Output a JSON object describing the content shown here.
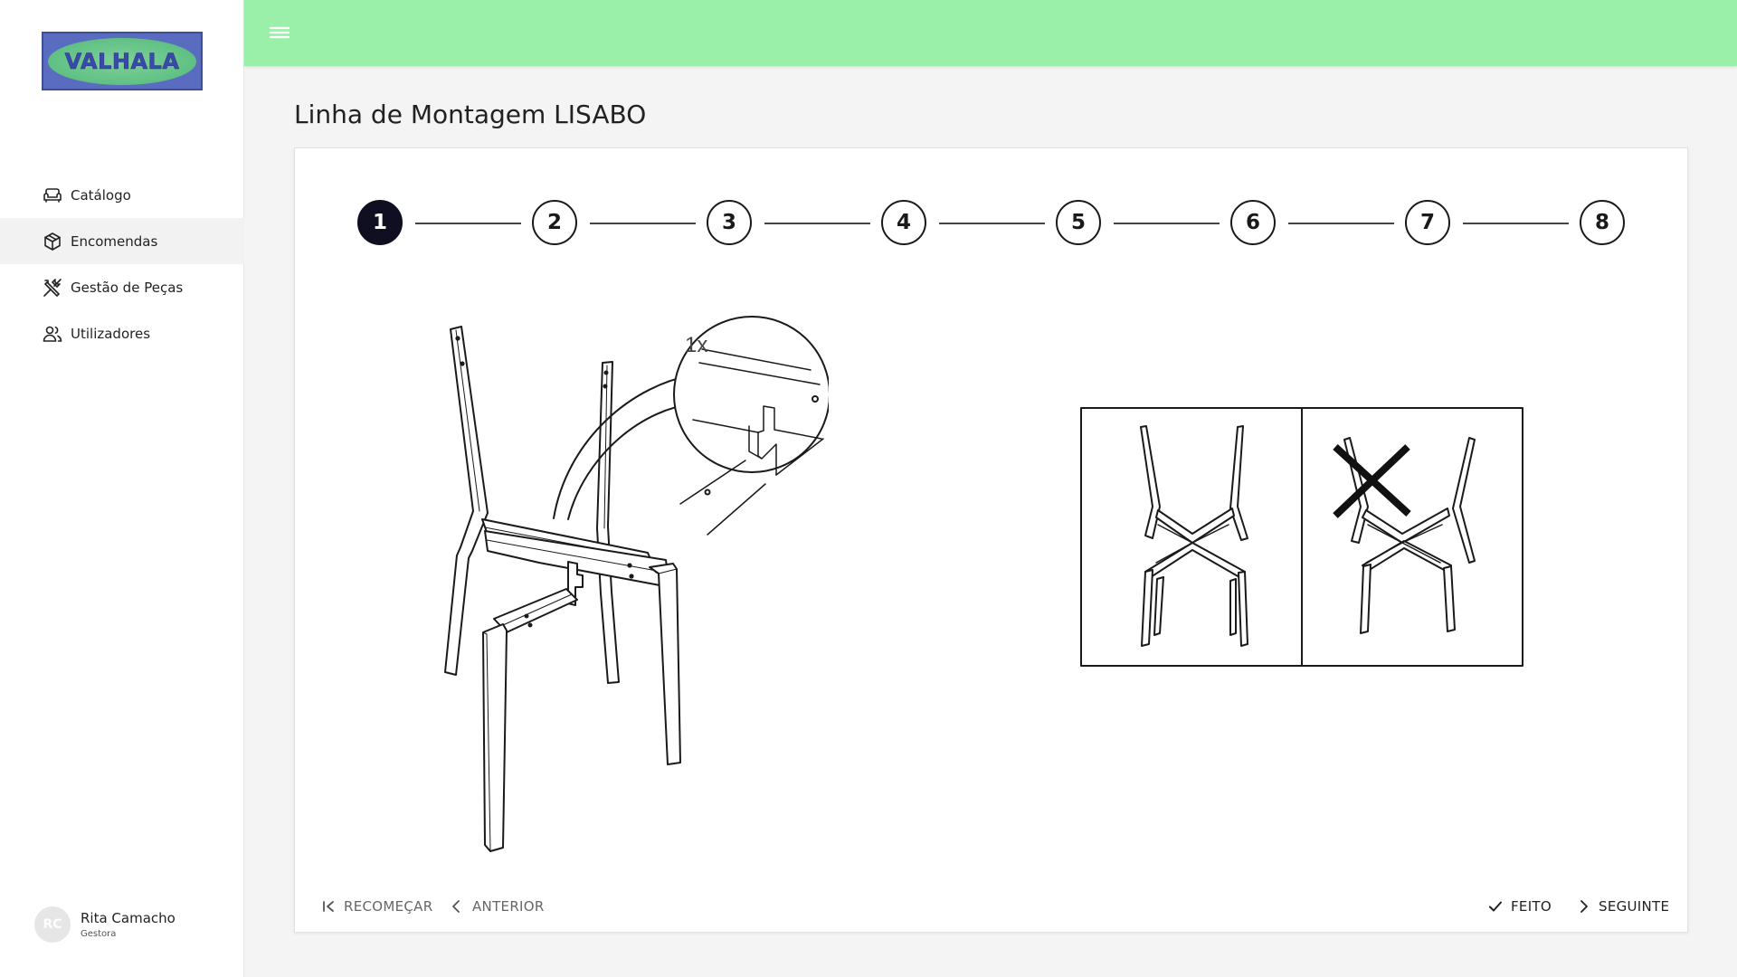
{
  "brand": {
    "logo_text": "VALHALA"
  },
  "sidebar": {
    "items": [
      {
        "label": "Catálogo",
        "icon": "sofa-icon",
        "active": false
      },
      {
        "label": "Encomendas",
        "icon": "package-icon",
        "active": true
      },
      {
        "label": "Gestão de Peças",
        "icon": "tools-icon",
        "active": false
      },
      {
        "label": "Utilizadores",
        "icon": "users-icon",
        "active": false
      }
    ]
  },
  "user": {
    "initials": "RC",
    "name": "Rita Camacho",
    "role": "Gestora"
  },
  "topbar": {
    "menu_icon": "hamburger-menu-icon",
    "color": "#9bf0a9"
  },
  "page": {
    "title": "Linha de Montagem LISABO"
  },
  "stepper": {
    "current": 1,
    "steps": [
      "1",
      "2",
      "3",
      "4",
      "5",
      "6",
      "7",
      "8"
    ]
  },
  "instruction": {
    "callout_quantity": "1x"
  },
  "actions": {
    "restart": "RECOMEÇAR",
    "previous": "ANTERIOR",
    "done": "FEITO",
    "next": "SEGUINTE"
  },
  "colors": {
    "active_step": "#100f22",
    "logo_bg": "#5a6cc0",
    "logo_ellipse": "#52b97a"
  }
}
